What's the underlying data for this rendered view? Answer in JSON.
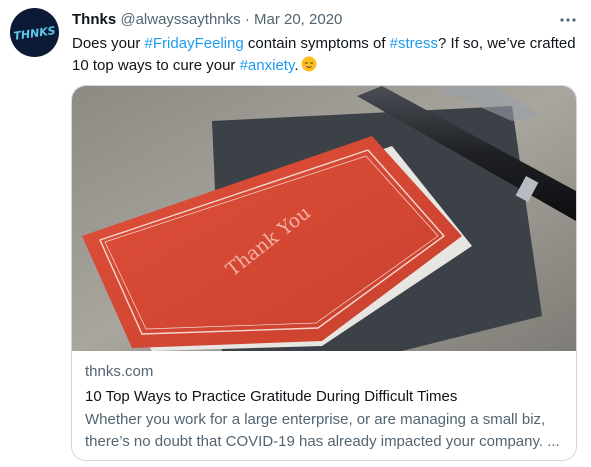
{
  "tweet": {
    "avatar": {
      "text": "THNKS",
      "bg": "#0d1a36",
      "fg": "#5ec8e8"
    },
    "display_name": "Thnks",
    "handle": "@alwayssaythnks",
    "separator": "·",
    "date": "Mar 20, 2020",
    "more_icon": "more-horizontal-icon",
    "text_parts": {
      "p1": "Does your ",
      "tag1": "#FridayFeeling",
      "p2": " contain symptoms of ",
      "tag2": "#stress",
      "p3": "? If so, we’ve crafted 10 top ways to cure your ",
      "tag3": "#anxiety",
      "p4": ".",
      "emoji": "relieved-face-emoji"
    },
    "link_color": "#1d9bf0"
  },
  "card": {
    "image_text": "Thank You",
    "domain": "thnks.com",
    "title": "10 Top Ways to Practice Gratitude During Difficult Times",
    "description": "Whether you work for a large enterprise, or are managing a small biz, there’s no doubt that COVID-19 has already impacted your company.  ..."
  }
}
